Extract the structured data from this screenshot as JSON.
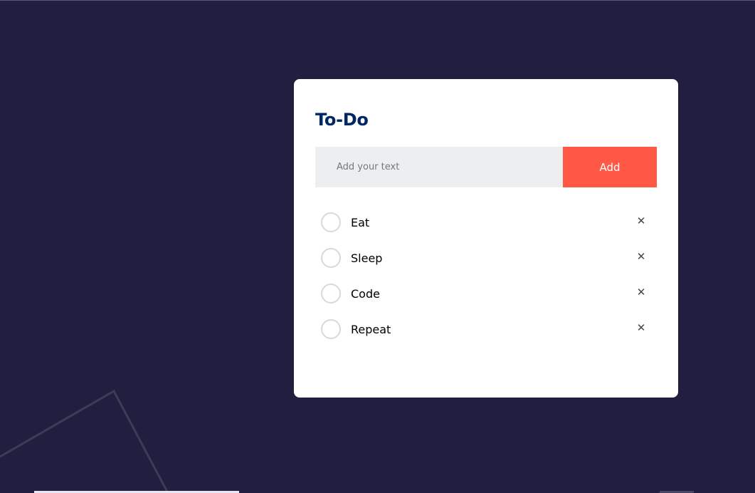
{
  "app": {
    "title": "To-Do"
  },
  "input": {
    "placeholder": "Add your text",
    "value": ""
  },
  "add_button": {
    "label": "Add"
  },
  "tasks": [
    {
      "label": "Eat",
      "checked": false
    },
    {
      "label": "Sleep",
      "checked": false
    },
    {
      "label": "Code",
      "checked": false
    },
    {
      "label": "Repeat",
      "checked": false
    }
  ],
  "icons": {
    "check": "circle-checkbox-icon",
    "remove": "close-icon"
  },
  "colors": {
    "page_background": "#221e40",
    "card_background": "#ffffff",
    "title": "#002765",
    "input_background": "#edeef0",
    "accent": "#ff5945"
  }
}
